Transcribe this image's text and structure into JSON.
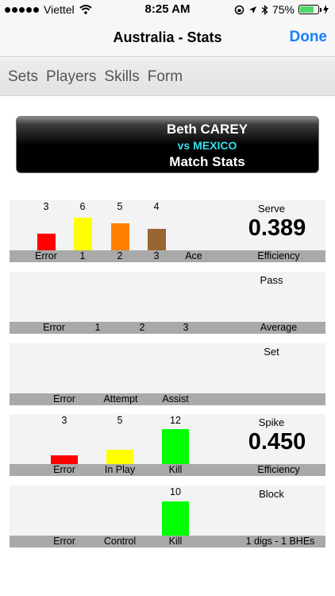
{
  "status_bar": {
    "carrier": "Viettel",
    "time": "8:25 AM",
    "battery": "75%"
  },
  "nav": {
    "title": "Australia - Stats",
    "done_label": "Done"
  },
  "tabs": [
    "Sets",
    "Players",
    "Skills",
    "Form"
  ],
  "header": {
    "player": "Beth CAREY",
    "opponent": "vs MEXICO",
    "subtitle": "Match Stats"
  },
  "panels": [
    {
      "title": "Serve",
      "value": "0.389",
      "footer": "Efficiency",
      "categories": [
        {
          "label": "Error",
          "count": "3",
          "color": "#ff0000"
        },
        {
          "label": "1",
          "count": "6",
          "color": "#ffff00"
        },
        {
          "label": "2",
          "count": "5",
          "color": "#ff8000"
        },
        {
          "label": "3",
          "count": "4",
          "color": "#996633"
        },
        {
          "label": "Ace",
          "count": "",
          "color": ""
        }
      ]
    },
    {
      "title": "Pass",
      "value": "",
      "footer": "Average",
      "categories": [
        {
          "label": "Error",
          "count": ""
        },
        {
          "label": "1",
          "count": ""
        },
        {
          "label": "2",
          "count": ""
        },
        {
          "label": "3",
          "count": ""
        }
      ]
    },
    {
      "title": "Set",
      "value": "",
      "footer": "",
      "categories": [
        {
          "label": "Error",
          "count": ""
        },
        {
          "label": "Attempt",
          "count": ""
        },
        {
          "label": "Assist",
          "count": ""
        }
      ]
    },
    {
      "title": "Spike",
      "value": "0.450",
      "footer": "Efficiency",
      "categories": [
        {
          "label": "Error",
          "count": "3",
          "color": "#ff0000"
        },
        {
          "label": "In Play",
          "count": "5",
          "color": "#ffff00"
        },
        {
          "label": "Kill",
          "count": "12",
          "color": "#00ff00"
        }
      ]
    },
    {
      "title": "Block",
      "value": "",
      "footer": "1 digs - 1 BHEs",
      "categories": [
        {
          "label": "Error",
          "count": ""
        },
        {
          "label": "Control",
          "count": ""
        },
        {
          "label": "Kill",
          "count": "10",
          "color": "#00ff00"
        }
      ]
    }
  ]
}
